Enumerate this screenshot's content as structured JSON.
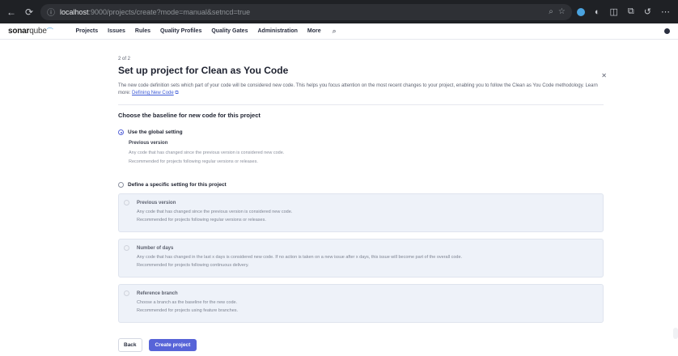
{
  "browser": {
    "url_host": "localhost",
    "url_path": ":9000/projects/create?mode=manual&setncd=true",
    "back_icon": "arrow-left",
    "forward_icon": "arrow-right",
    "reload_icon": "reload",
    "info_icon": "info-circle"
  },
  "header": {
    "logo_bold": "sonar",
    "logo_light": "qube",
    "nav": [
      "Projects",
      "Issues",
      "Rules",
      "Quality Profiles",
      "Quality Gates",
      "Administration",
      "More"
    ]
  },
  "page": {
    "step": "2 of 2",
    "title": "Set up project for Clean as You Code",
    "description": "The new code definition sets which part of your code will be considered new code. This helps you focus attention on the most recent changes to your project, enabling you to follow the Clean as You Code methodology. Learn more: ",
    "learn_more_link": "Defining New Code",
    "section_title": "Choose the baseline for new code for this project",
    "global": {
      "label": "Use the global setting",
      "checked": true,
      "title": "Previous version",
      "line1": "Any code that has changed since the previous version is considered new code.",
      "line2": "Recommended for projects following regular versions or releases."
    },
    "specific": {
      "label": "Define a specific setting for this project",
      "checked": false,
      "options": [
        {
          "title": "Previous version",
          "line1": "Any code that has changed since the previous version is considered new code.",
          "line2": "Recommended for projects following regular versions or releases."
        },
        {
          "title": "Number of days",
          "line1": "Any code that has changed in the last x days is considered new code. If no action is taken on a new issue after x days, this issue will become part of the overall code.",
          "line2": "Recommended for projects following continuous delivery."
        },
        {
          "title": "Reference branch",
          "line1": "Choose a branch as the baseline for the new code.",
          "line2": "Recommended for projects using feature branches."
        }
      ]
    },
    "back_label": "Back",
    "create_label": "Create project"
  },
  "colors": {
    "accent": "#5764d8",
    "card_bg": "#eef2f9",
    "browser_chrome": "#1f2125"
  }
}
